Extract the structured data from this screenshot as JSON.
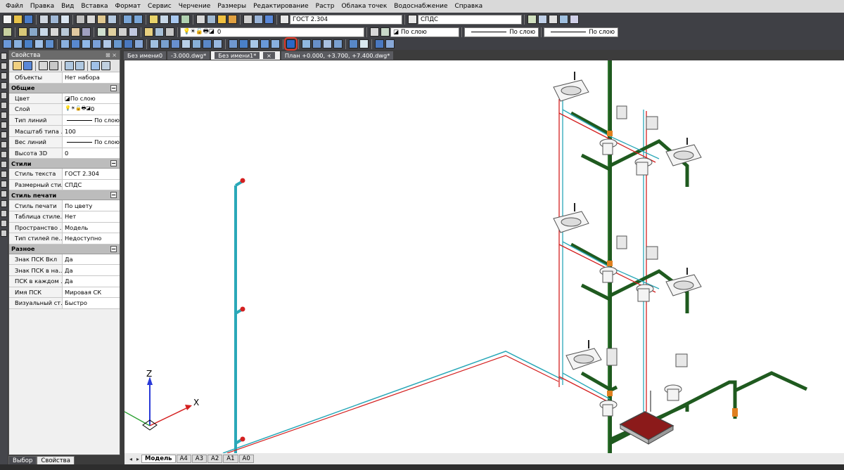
{
  "menu": [
    "Файл",
    "Правка",
    "Вид",
    "Вставка",
    "Формат",
    "Сервис",
    "Черчение",
    "Размеры",
    "Редактирование",
    "Растр",
    "Облака точек",
    "Водоснабжение",
    "Справка"
  ],
  "toolbar": {
    "text_style": "ГОСТ 2.304",
    "dim_style": "СПДС",
    "layer": "0",
    "color": "По слою",
    "linetype": "По слою",
    "lineweight": "По слою"
  },
  "properties": {
    "title": "Свойства",
    "close_glyph": "⊠ ×",
    "objects_label": "Объекты",
    "objects_value": "Нет набора",
    "sections": [
      {
        "name": "Общие",
        "rows": [
          {
            "k": "Цвет",
            "v": "По слою"
          },
          {
            "k": "Слой",
            "v": "0"
          },
          {
            "k": "Тип линий",
            "v": "По слою"
          },
          {
            "k": "Масштаб типа ...",
            "v": "100"
          },
          {
            "k": "Вес линий",
            "v": "По слою"
          },
          {
            "k": "Высота 3D",
            "v": "0"
          }
        ]
      },
      {
        "name": "Стили",
        "rows": [
          {
            "k": "Стиль текста",
            "v": "ГОСТ 2.304"
          },
          {
            "k": "Размерный стиль",
            "v": "СПДС"
          }
        ]
      },
      {
        "name": "Стиль печати",
        "rows": [
          {
            "k": "Стиль печати",
            "v": "По цвету"
          },
          {
            "k": "Таблица стиле...",
            "v": "Нет"
          },
          {
            "k": "Пространство ...",
            "v": "Модель"
          },
          {
            "k": "Тип стилей пе...",
            "v": "Недоступно"
          }
        ]
      },
      {
        "name": "Разное",
        "rows": [
          {
            "k": "Знак ПСК Вкл",
            "v": "Да"
          },
          {
            "k": "Знак ПСК в на...",
            "v": "Да"
          },
          {
            "k": "ПСК в каждом ...",
            "v": "Да"
          },
          {
            "k": "Имя ПСК",
            "v": "Мировая СК"
          },
          {
            "k": "Визуальный ст...",
            "v": "Быстро"
          }
        ]
      }
    ]
  },
  "bottom_tabs": [
    "Выбор",
    "Свойства"
  ],
  "doc_tabs": [
    "Без имени0",
    "-3.000.dwg*",
    "Без имени1*",
    "План +0.000, +3.700, +7.400.dwg*"
  ],
  "doc_tab_close": "×",
  "layout_tabs": [
    "Модель",
    "A4",
    "A3",
    "A2",
    "A1",
    "A0"
  ],
  "axis": {
    "z": "Z",
    "x": "X"
  },
  "colors": {
    "drain": "#1f5a1f",
    "cold": "#2aa8b8",
    "hot": "#d42020",
    "accent": "#e23a2a"
  }
}
